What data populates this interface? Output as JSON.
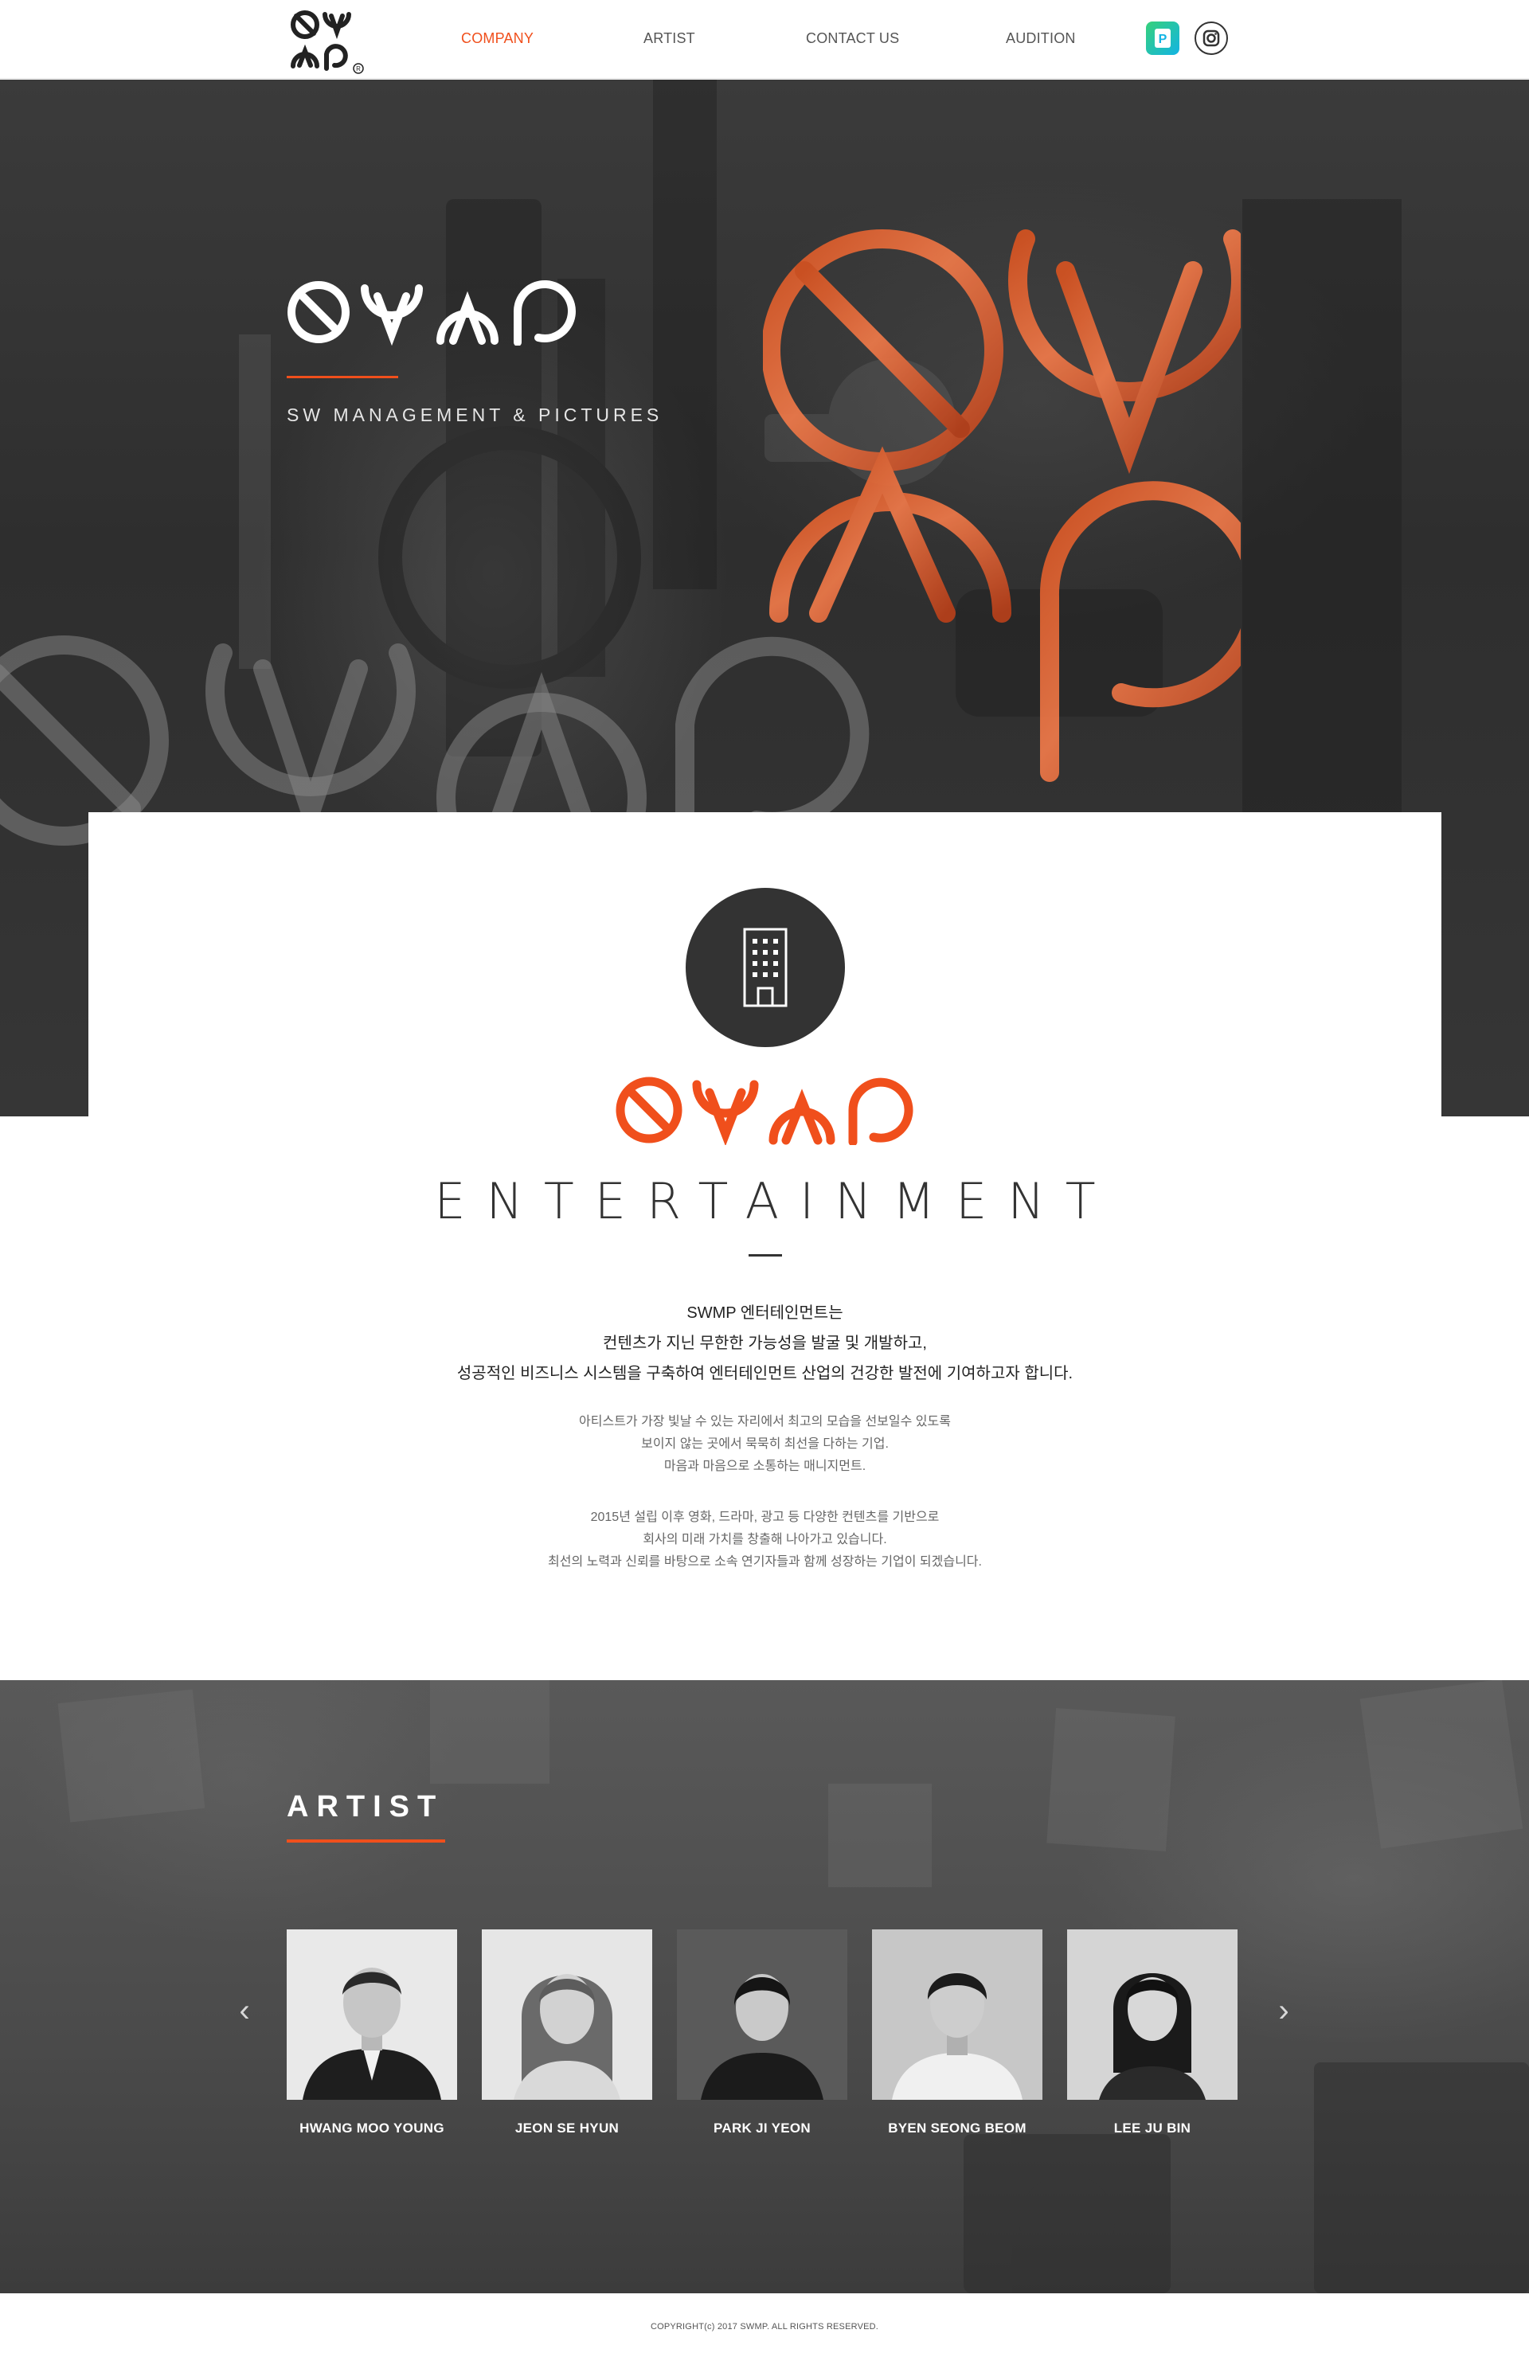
{
  "nav": {
    "logo_text": "SWMP",
    "items": [
      {
        "label": "COMPANY",
        "active": true
      },
      {
        "label": "ARTIST",
        "active": false
      },
      {
        "label": "CONTACT US",
        "active": false
      },
      {
        "label": "AUDITION",
        "active": false
      }
    ],
    "sns": [
      {
        "icon": "post-icon",
        "color": "#1fc07a"
      },
      {
        "icon": "instagram-icon",
        "color": "#333333"
      }
    ]
  },
  "hero": {
    "logo_text": "SWMP",
    "subtitle": "SW MANAGEMENT & PICTURES"
  },
  "company": {
    "icon": "building-icon",
    "logo_text": "SWMP",
    "title": "ENTERTAINMENT",
    "lead": [
      "SWMP 엔터테인먼트는",
      "컨텐츠가 지닌 무한한 가능성을 발굴 및 개발하고,",
      "성공적인 비즈니스 시스템을 구축하여 엔터테인먼트 산업의 건강한 발전에 기여하고자 합니다."
    ],
    "para1": [
      "아티스트가 가장 빛날 수 있는 자리에서 최고의 모습을 선보일수 있도록",
      "보이지 않는 곳에서 묵묵히 최선을 다하는 기업.",
      "마음과 마음으로 소통하는 매니지먼트."
    ],
    "para2": [
      "2015년 설립 이후 영화, 드라마, 광고 등 다양한 컨텐츠를 기반으로",
      "회사의 미래 가치를 창출해 나아가고 있습니다.",
      "최선의 노력과 신뢰를 바탕으로 소속 연기자들과 함께 성장하는 기업이 되겠습니다."
    ]
  },
  "artist_section": {
    "title": "ARTIST",
    "prev_icon": "chevron-left-icon",
    "next_icon": "chevron-right-icon",
    "prev_glyph": "‹",
    "next_glyph": "›",
    "artists": [
      {
        "name": "HWANG MOO YOUNG"
      },
      {
        "name": "JEON SE HYUN"
      },
      {
        "name": "PARK JI YEON"
      },
      {
        "name": "BYEN SEONG BEOM"
      },
      {
        "name": "LEE JU BIN"
      }
    ]
  },
  "colors": {
    "accent": "#f04f1c",
    "dark": "#333333"
  },
  "footer": {
    "copyright": "COPYRIGHT(c) 2017 SWMP. ALL RIGHTS RESERVED."
  }
}
